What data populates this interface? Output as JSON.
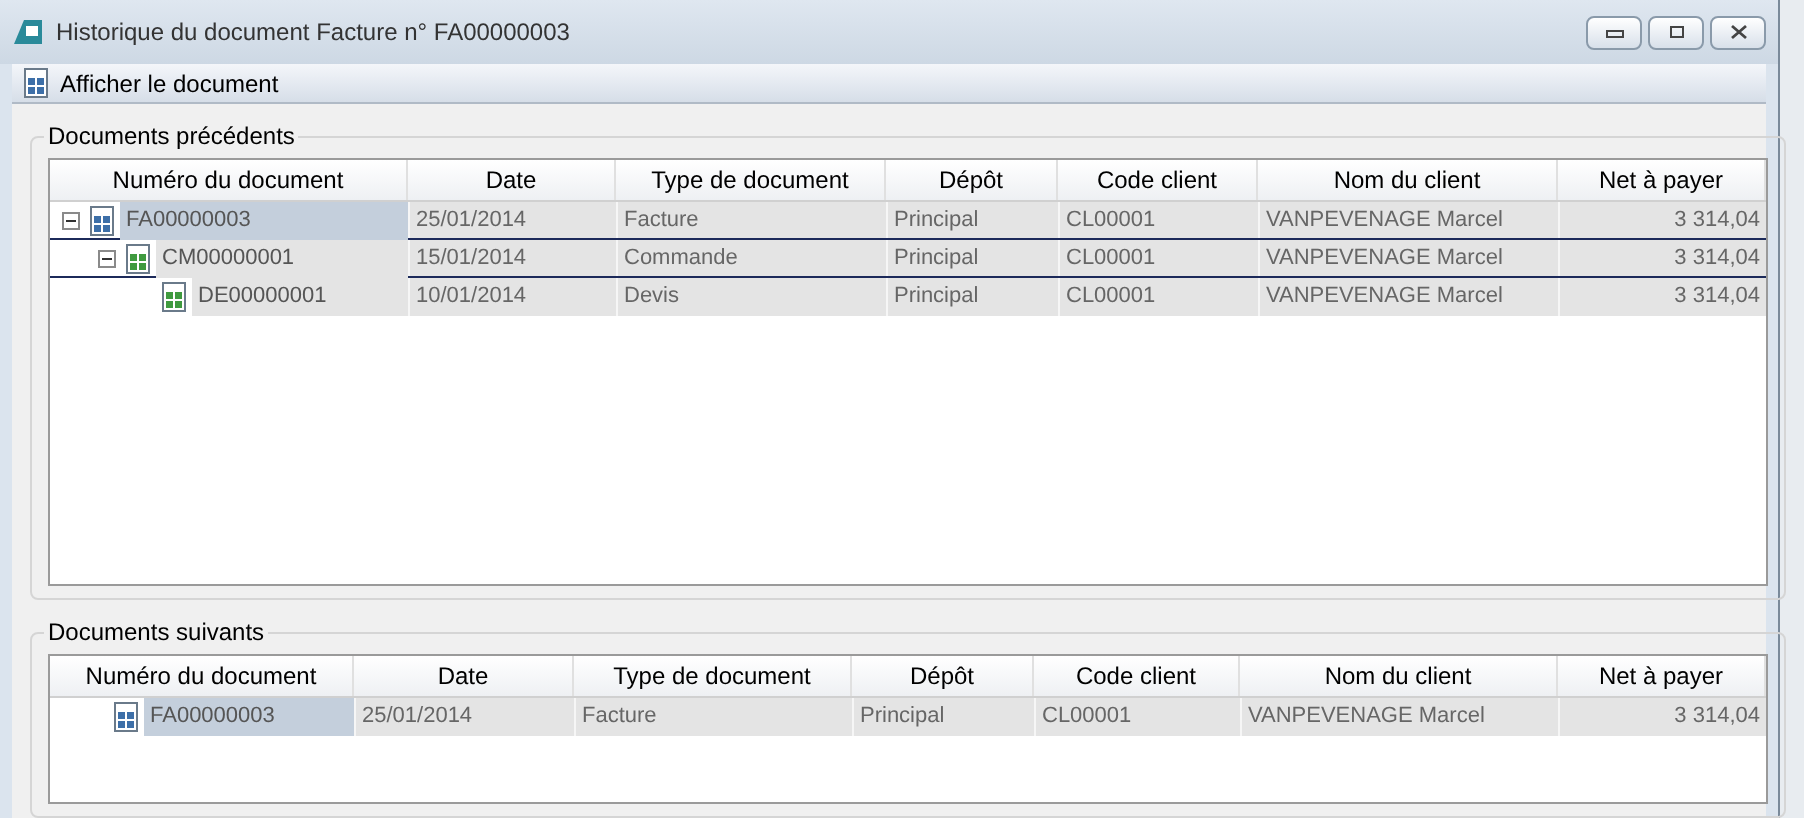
{
  "window": {
    "title": "Historique du document Facture n° FA00000003"
  },
  "toolbar": {
    "label": "Afficher le document"
  },
  "previous": {
    "title": "Documents précédents",
    "columns": [
      "Numéro du document",
      "Date",
      "Type de document",
      "Dépôt",
      "Code client",
      "Nom du client",
      "Net à payer"
    ],
    "rows": [
      {
        "color": "#3d6fa8",
        "selected": true,
        "expanded": true,
        "cells": [
          "FA00000003",
          "25/01/2014",
          "Facture",
          "Principal",
          "CL00001",
          "VANPEVENAGE Marcel",
          "3 314,04"
        ],
        "children": [
          {
            "color": "#3f9a3f",
            "selected": false,
            "expanded": true,
            "cells": [
              "CM00000001",
              "15/01/2014",
              "Commande",
              "Principal",
              "CL00001",
              "VANPEVENAGE Marcel",
              "3 314,04"
            ],
            "children": [
              {
                "color": "#3f9a3f",
                "selected": false,
                "cells": [
                  "DE00000001",
                  "10/01/2014",
                  "Devis",
                  "Principal",
                  "CL00001",
                  "VANPEVENAGE Marcel",
                  "3 314,04"
                ]
              }
            ]
          }
        ]
      }
    ]
  },
  "next": {
    "title": "Documents suivants",
    "columns": [
      "Numéro du document",
      "Date",
      "Type de document",
      "Dépôt",
      "Code client",
      "Nom du client",
      "Net à payer"
    ],
    "rows": [
      {
        "color": "#3d6fa8",
        "selected": true,
        "cells": [
          "FA00000003",
          "25/01/2014",
          "Facture",
          "Principal",
          "CL00001",
          "VANPEVENAGE Marcel",
          "3 314,04"
        ]
      }
    ]
  }
}
